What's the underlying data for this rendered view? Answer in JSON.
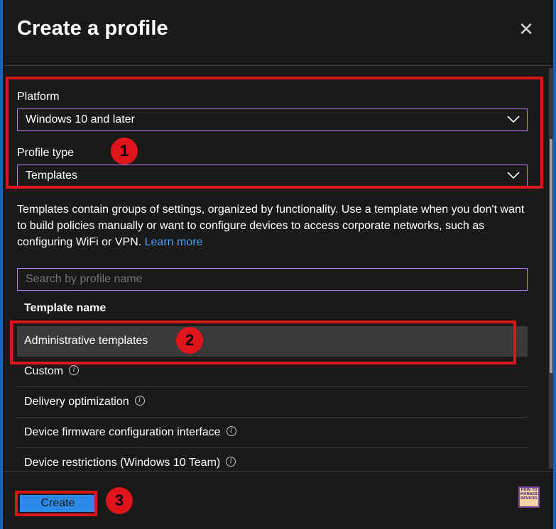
{
  "header": {
    "title": "Create a profile"
  },
  "platform": {
    "label": "Platform",
    "value": "Windows 10 and later"
  },
  "profile_type": {
    "label": "Profile type",
    "value": "Templates"
  },
  "description": {
    "text": "Templates contain groups of settings, organized by functionality. Use a template when you don't want to build policies manually or want to configure devices to access corporate networks, such as configuring WiFi or VPN.",
    "link": "Learn more"
  },
  "search": {
    "placeholder": "Search by profile name"
  },
  "table": {
    "header": "Template name",
    "rows": [
      {
        "label": "Administrative templates",
        "info": false
      },
      {
        "label": "Custom",
        "info": true
      },
      {
        "label": "Delivery optimization",
        "info": true
      },
      {
        "label": "Device firmware configuration interface",
        "info": true
      },
      {
        "label": "Device restrictions (Windows 10 Team)",
        "info": true
      }
    ]
  },
  "footer": {
    "create_label": "Create"
  },
  "annotations": {
    "step1": "1",
    "step2": "2",
    "step3": "3"
  },
  "logo": {
    "line1": "HOW TO",
    "line2": "MANAGE",
    "line3": "DEVICES"
  },
  "colors": {
    "accent": "#479ef5",
    "highlight": "#e0141b",
    "button": "#2b8ae8",
    "input_border": "#b57cff"
  }
}
